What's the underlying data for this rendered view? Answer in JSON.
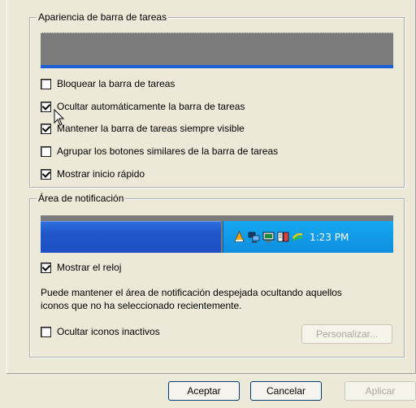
{
  "taskbar_group": {
    "title": "Apariencia de barra de tareas",
    "options": [
      {
        "label": "Bloquear la barra de tareas",
        "checked": false
      },
      {
        "label": "Ocultar automáticamente la barra de tareas",
        "checked": true
      },
      {
        "label": "Mantener la barra de tareas siempre visible",
        "checked": true
      },
      {
        "label": "Agrupar los botones similares de la barra de tareas",
        "checked": false
      },
      {
        "label": "Mostrar inicio rápido",
        "checked": true
      }
    ]
  },
  "notification_group": {
    "title": "Área de notificación",
    "tray_icons": [
      "vlc-icon",
      "network-icon",
      "monitor-icon",
      "book-icon",
      "updates-icon"
    ],
    "clock": "1:23 PM",
    "show_clock": {
      "label": "Mostrar el reloj",
      "checked": true
    },
    "description_line1": "Puede mantener el área de notificación despejada ocultando aquellos",
    "description_line2": "iconos que no ha seleccionado recientemente.",
    "hide_inactive": {
      "label": "Ocultar iconos inactivos",
      "checked": false
    },
    "customize_label": "Personalizar..."
  },
  "footer": {
    "ok_label": "Aceptar",
    "cancel_label": "Cancelar",
    "apply_label": "Aplicar"
  },
  "colors": {
    "taskbar_blue": "#1f55c8",
    "tray_blue": "#0e8ee0",
    "dialog_bg": "#ece9d8"
  }
}
